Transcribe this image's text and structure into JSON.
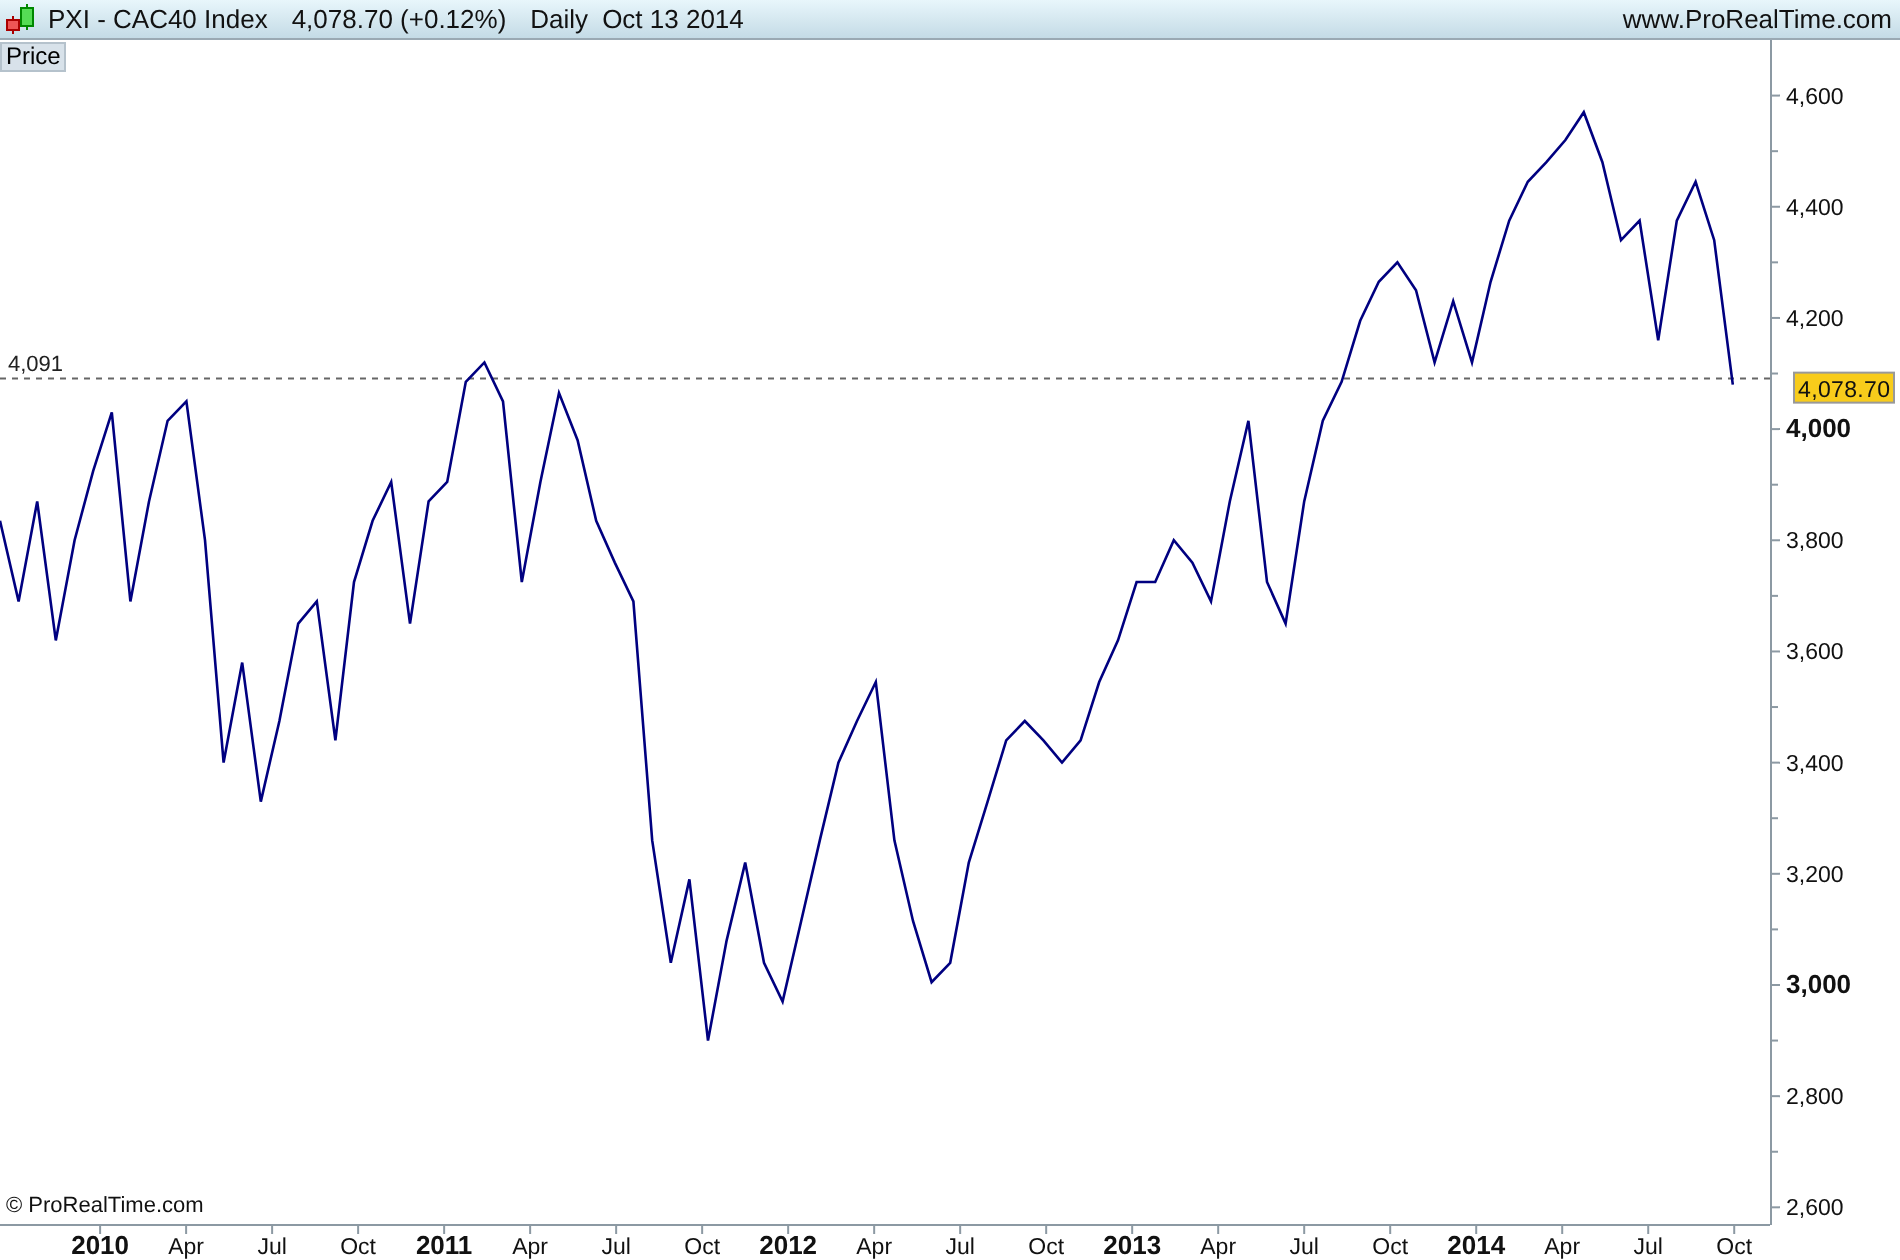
{
  "header": {
    "symbol": "PXI - CAC40 Index",
    "quote": "4,078.70 (+0.12%)",
    "period": "Daily",
    "date": "Oct 13 2014",
    "website": "www.ProRealTime.com"
  },
  "panel": {
    "label": "Price",
    "copyright": "© ProRealTime.com",
    "last_price": "4,078.70",
    "chart_data": {
      "type": "line",
      "x": [
        2009.709,
        2009.763,
        2009.817,
        2009.871,
        2009.926,
        2009.98,
        2010.034,
        2010.088,
        2010.142,
        2010.196,
        2010.251,
        2010.305,
        2010.359,
        2010.413,
        2010.467,
        2010.521,
        2010.576,
        2010.63,
        2010.684,
        2010.738,
        2010.792,
        2010.846,
        2010.901,
        2010.955,
        2011.009,
        2011.063,
        2011.117,
        2011.171,
        2011.226,
        2011.28,
        2011.334,
        2011.388,
        2011.442,
        2011.496,
        2011.55,
        2011.605,
        2011.659,
        2011.713,
        2011.767,
        2011.821,
        2011.875,
        2011.93,
        2011.984,
        2012.038,
        2012.092,
        2012.146,
        2012.2,
        2012.255,
        2012.309,
        2012.363,
        2012.417,
        2012.471,
        2012.525,
        2012.58,
        2012.634,
        2012.688,
        2012.742,
        2012.796,
        2012.85,
        2012.904,
        2012.959,
        2013.013,
        2013.067,
        2013.121,
        2013.175,
        2013.229,
        2013.284,
        2013.338,
        2013.392,
        2013.446,
        2013.5,
        2013.554,
        2013.609,
        2013.663,
        2013.717,
        2013.771,
        2013.825,
        2013.879,
        2013.933,
        2013.988,
        2014.042,
        2014.096,
        2014.15,
        2014.204,
        2014.259,
        2014.313,
        2014.367,
        2014.421,
        2014.475,
        2014.529,
        2014.583,
        2014.638,
        2014.692,
        2014.746
      ],
      "series": [
        {
          "color": "#000080",
          "values": [
            3835,
            3690,
            3870,
            3620,
            3800,
            3925,
            4030,
            3690,
            3870,
            4015,
            4050,
            3800,
            3400,
            3580,
            3330,
            3475,
            3650,
            3690,
            3440,
            3725,
            3835,
            3905,
            3650,
            3870,
            3905,
            4085,
            4120,
            4050,
            3725,
            3905,
            4065,
            3980,
            3835,
            3760,
            3690,
            3260,
            3040,
            3190,
            2900,
            3080,
            3220,
            3040,
            2970,
            3115,
            3260,
            3400,
            3475,
            3545,
            3260,
            3115,
            3005,
            3040,
            3220,
            3330,
            3440,
            3475,
            3440,
            3400,
            3440,
            3545,
            3620,
            3725,
            3725,
            3800,
            3760,
            3690,
            3870,
            4015,
            3725,
            3650,
            3870,
            4015,
            4085,
            4195,
            4265,
            4300,
            4250,
            4120,
            4230,
            4120,
            4265,
            4375,
            4445,
            4480,
            4520,
            4570,
            4480,
            4340,
            4375,
            4160,
            4375,
            4445,
            4340,
            4080
          ]
        }
      ],
      "xlim": [
        2009.709,
        2014.854
      ],
      "ylim": [
        2570,
        4700
      ],
      "xticks": [
        {
          "value": 2010,
          "label": "2010"
        },
        {
          "value": 2010.25,
          "label": "Apr"
        },
        {
          "value": 2010.5,
          "label": "Jul"
        },
        {
          "value": 2010.75,
          "label": "Oct"
        },
        {
          "value": 2011,
          "label": "2011"
        },
        {
          "value": 2011.25,
          "label": "Apr"
        },
        {
          "value": 2011.5,
          "label": "Jul"
        },
        {
          "value": 2011.75,
          "label": "Oct"
        },
        {
          "value": 2012,
          "label": "2012"
        },
        {
          "value": 2012.25,
          "label": "Apr"
        },
        {
          "value": 2012.5,
          "label": "Jul"
        },
        {
          "value": 2012.75,
          "label": "Oct"
        },
        {
          "value": 2013,
          "label": "2013"
        },
        {
          "value": 2013.25,
          "label": "Apr"
        },
        {
          "value": 2013.5,
          "label": "Jul"
        },
        {
          "value": 2013.75,
          "label": "Oct"
        },
        {
          "value": 2014,
          "label": "2014"
        },
        {
          "value": 2014.25,
          "label": "Apr"
        },
        {
          "value": 2014.5,
          "label": "Jul"
        },
        {
          "value": 2014.75,
          "label": "Oct"
        }
      ],
      "yticks": [
        {
          "value": 2600,
          "label": "2,600"
        },
        {
          "value": 2800,
          "label": "2,800"
        },
        {
          "value": 3000,
          "label": "3,000"
        },
        {
          "value": 3200,
          "label": "3,200"
        },
        {
          "value": 3400,
          "label": "3,400"
        },
        {
          "value": 3600,
          "label": "3,600"
        },
        {
          "value": 3800,
          "label": "3,800"
        },
        {
          "value": 4000,
          "label": "4,000"
        },
        {
          "value": 4200,
          "label": "4,200"
        },
        {
          "value": 4400,
          "label": "4,400"
        },
        {
          "value": 4600,
          "label": "4,600"
        }
      ],
      "ref_lines": [
        {
          "axis": "y",
          "value": 4091,
          "label": "4,091"
        }
      ]
    }
  }
}
